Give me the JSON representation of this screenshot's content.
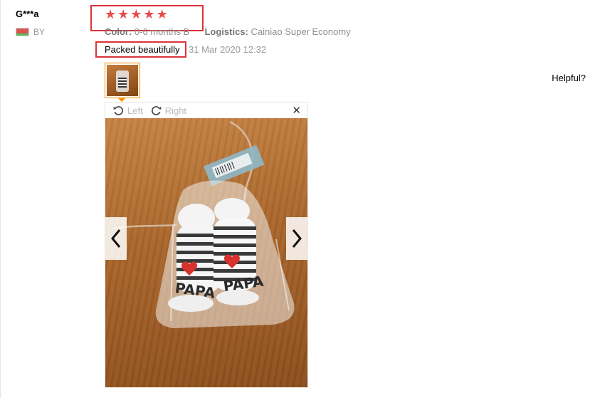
{
  "review": {
    "user_name": "G***a",
    "country_code": "BY",
    "rating": 5,
    "stars": [
      "★",
      "★",
      "★",
      "★",
      "★"
    ],
    "color_label": "Color:",
    "color_value": "0-6 months B",
    "logistics_label": "Logistics:",
    "logistics_value": "Cainiao Super Economy",
    "feedback_text": "Packed beautifully",
    "date": "31 Mar 2020 12:32",
    "helpful_label": "Helpful?"
  },
  "viewer": {
    "rotate_left_label": "Left",
    "rotate_right_label": "Right",
    "close_glyph": "✕",
    "photo_text": "PAPA"
  },
  "colors": {
    "star": "#e94c4c",
    "highlight_box": "#d9343a",
    "thumb_border": "#ff8c00",
    "muted_text": "#999999"
  },
  "icons": [
    "flag-icon",
    "star-icon",
    "rotate-left-icon",
    "rotate-right-icon",
    "close-icon",
    "chevron-left-icon",
    "chevron-right-icon"
  ]
}
